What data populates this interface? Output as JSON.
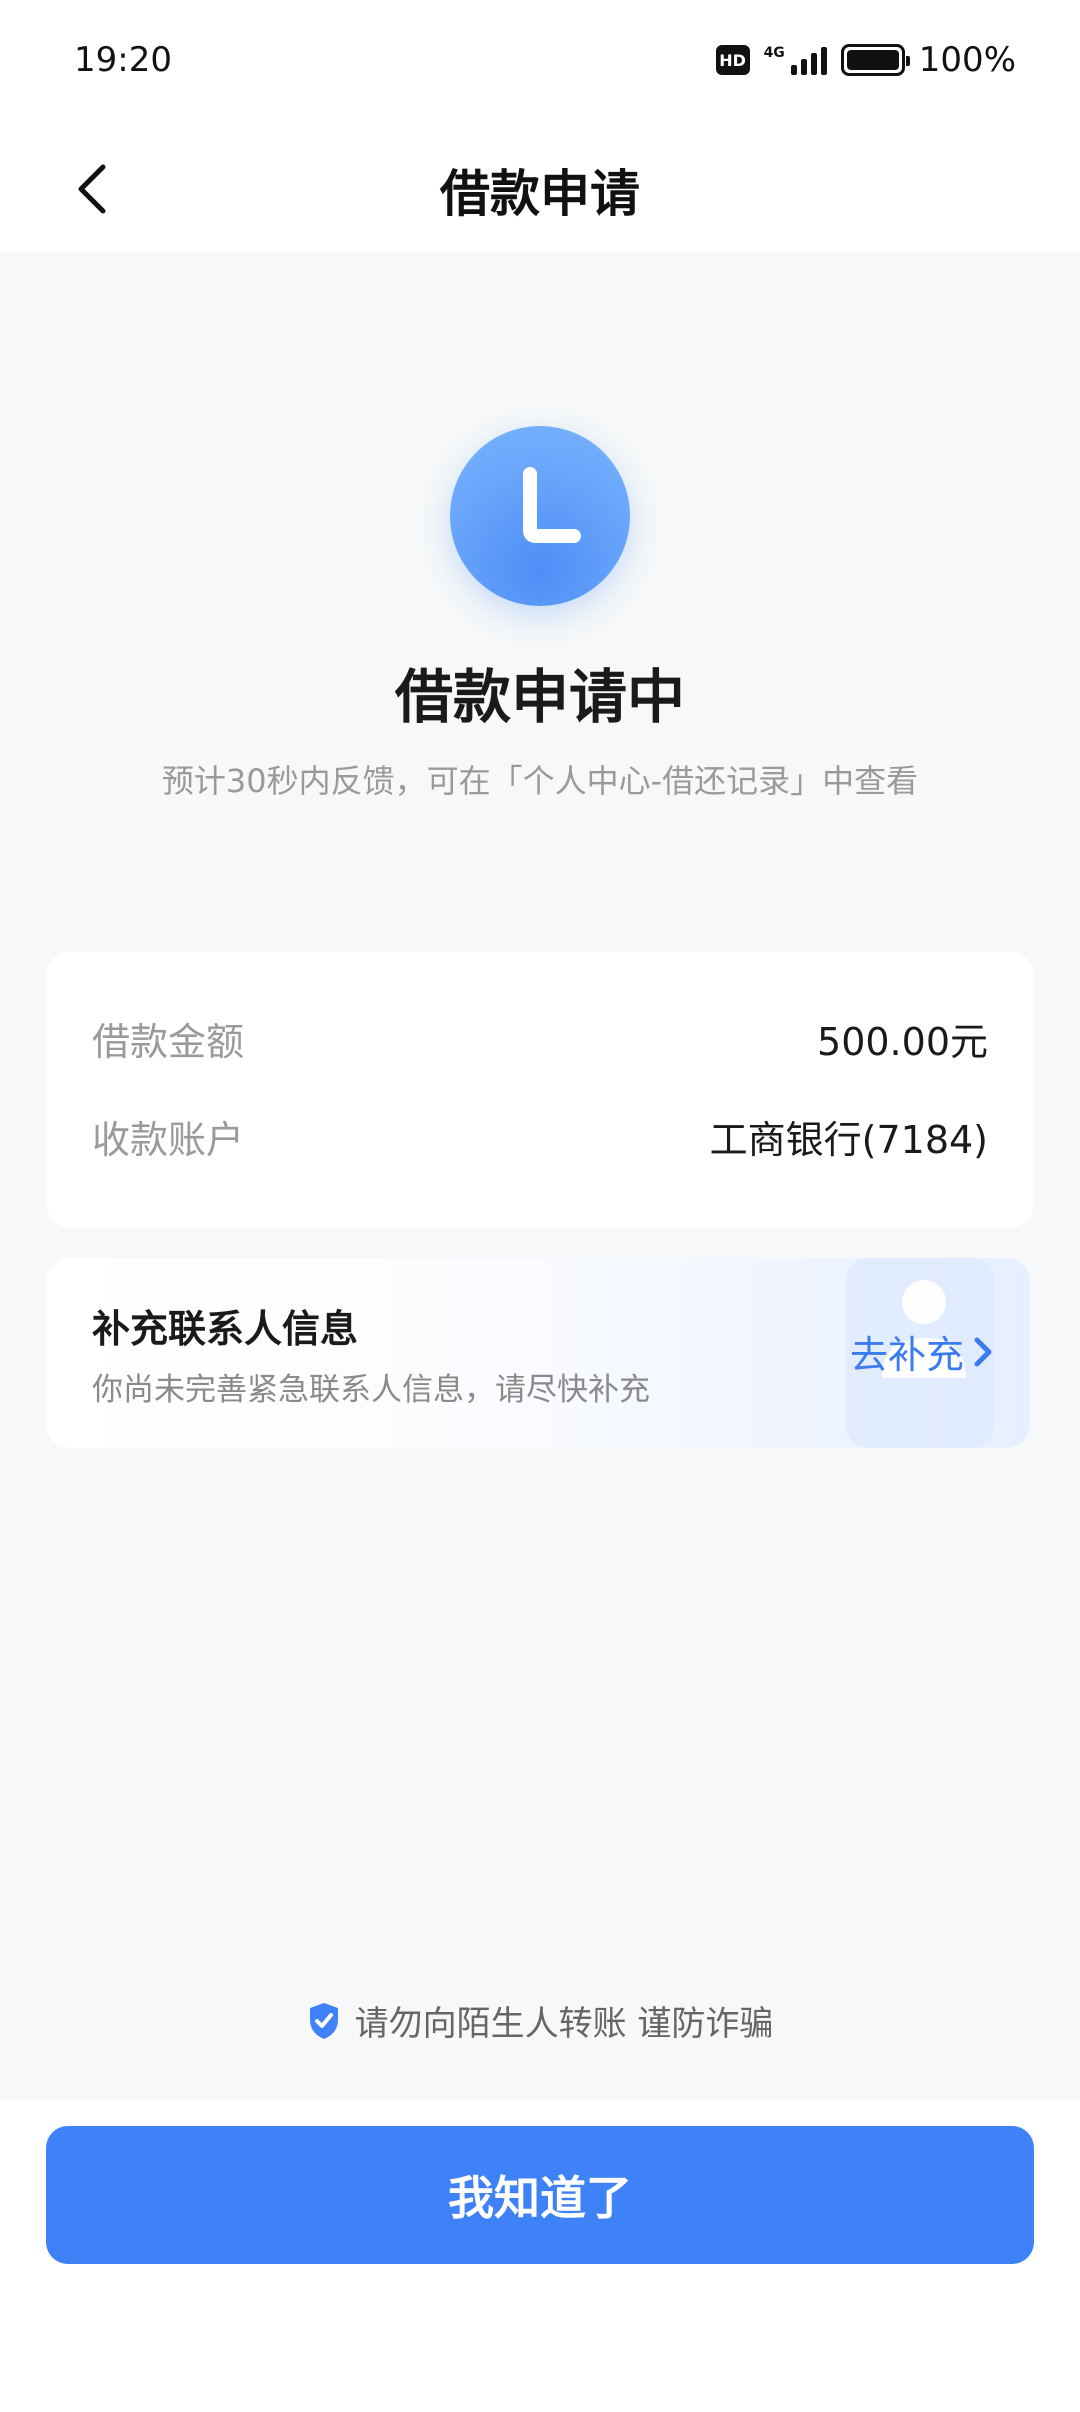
{
  "status_bar": {
    "time": "19:20",
    "hd": "HD",
    "network": "4G",
    "battery": "100%"
  },
  "nav": {
    "title": "借款申请"
  },
  "status": {
    "title": "借款申请中",
    "subtitle": "预计30秒内反馈，可在「个人中心-借还记录」中查看"
  },
  "info": {
    "rows": [
      {
        "label": "借款金额",
        "value": "500.00元"
      },
      {
        "label": "收款账户",
        "value": "工商银行(7184)"
      }
    ]
  },
  "contact": {
    "title": "补充联系人信息",
    "desc": "你尚未完善紧急联系人信息，请尽快补充",
    "action": "去补充"
  },
  "safety": {
    "text": "请勿向陌生人转账 谨防诈骗"
  },
  "button": {
    "label": "我知道了"
  },
  "colors": {
    "accent": "#3f82f7",
    "background": "#f6f8f9",
    "link": "#3a7bf0"
  },
  "icons": [
    "back-arrow-icon",
    "clock-icon",
    "chevron-right-icon",
    "shield-check-icon",
    "person-icon"
  ]
}
